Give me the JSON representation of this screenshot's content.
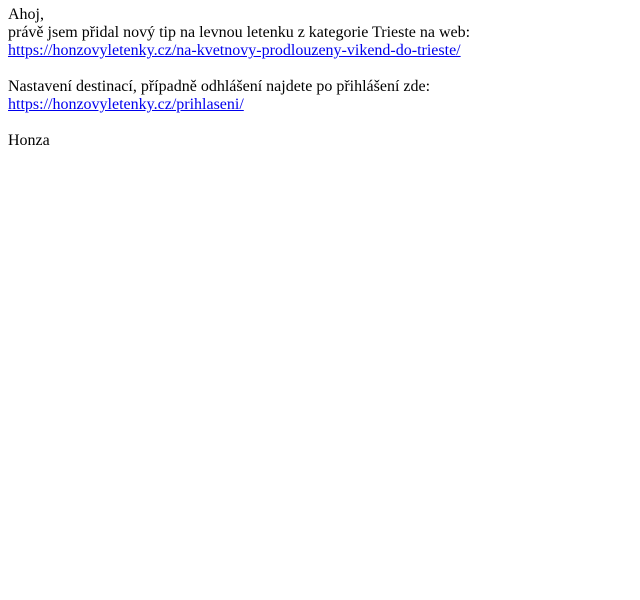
{
  "email": {
    "greeting": "Ahoj,",
    "intro": "právě jsem přidal nový tip na levnou letenku z kategorie Trieste na web:",
    "tip_link": "https://honzovyletenky.cz/na-kvetnovy-prodlouzeny-vikend-do-trieste/",
    "settings_text": "Nastavení destinací, případně odhlášení najdete po přihlášení zde:",
    "login_link": "https://honzovyletenky.cz/prihlaseni/",
    "signature": "Honza",
    "colors": {
      "text": "#000000",
      "link": "#0000ee",
      "background": "#ffffff"
    }
  }
}
